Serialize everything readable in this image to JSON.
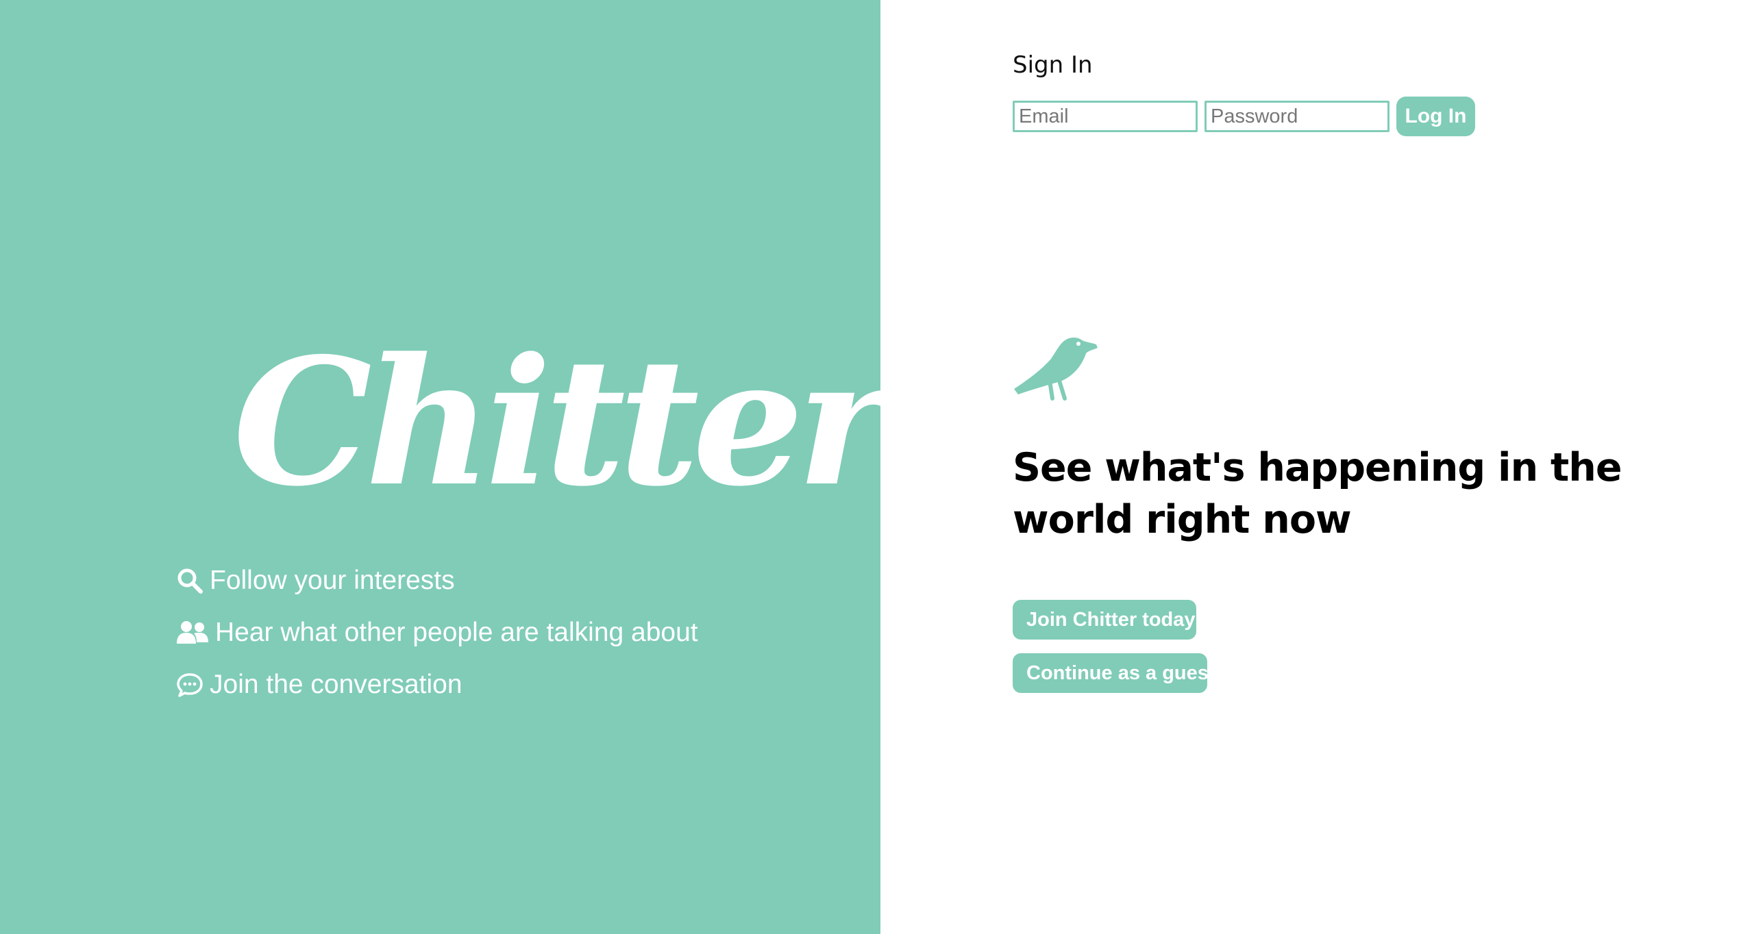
{
  "brand": {
    "name": "Chitter",
    "accent_color": "#80ccb7"
  },
  "features": [
    {
      "icon": "search-icon",
      "label": "Follow your interests"
    },
    {
      "icon": "users-icon",
      "label": "Hear what other people are talking about"
    },
    {
      "icon": "chat-bubble-icon",
      "label": "Join the conversation"
    }
  ],
  "signin": {
    "title": "Sign In",
    "email_placeholder": "Email",
    "password_placeholder": "Password",
    "login_label": "Log In"
  },
  "hero": {
    "icon": "bird-icon",
    "headline": "See what's happening in the world right now",
    "join_label": "Join Chitter today",
    "guest_label": "Continue as a guest"
  }
}
